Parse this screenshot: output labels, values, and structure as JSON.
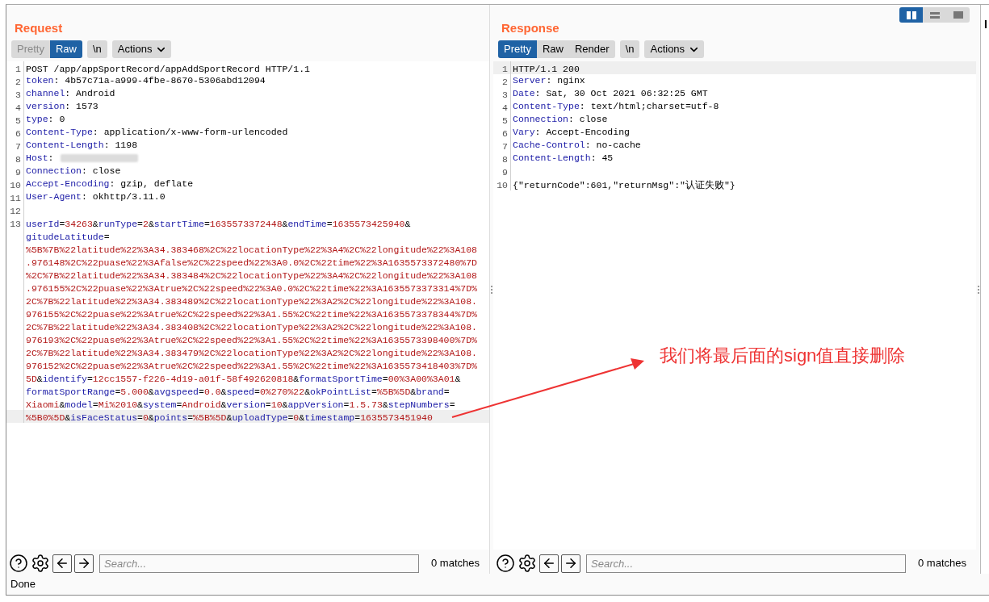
{
  "request": {
    "title": "Request",
    "tabs": [
      {
        "label": "Pretty",
        "selected": false,
        "disabled": true
      },
      {
        "label": "Raw",
        "selected": true
      }
    ],
    "newline_button": "\\n",
    "actions": "Actions",
    "lines": [
      {
        "num": "1",
        "kind": "plain",
        "text": "POST /app/appSportRecord/appAddSportRecord HTTP/1.1",
        "current": false
      },
      {
        "num": "2",
        "kind": "header",
        "text": "token: 4b57c71a-a999-4fbe-8670-5306abd12094",
        "current": false
      },
      {
        "num": "3",
        "kind": "header",
        "text": "channel: Android",
        "current": false
      },
      {
        "num": "4",
        "kind": "header",
        "text": "version: 1573",
        "current": false
      },
      {
        "num": "5",
        "kind": "header",
        "text": "type: 0",
        "current": false
      },
      {
        "num": "6",
        "kind": "header",
        "text": "Content-Type: application/x-www-form-urlencoded",
        "current": false
      },
      {
        "num": "7",
        "kind": "header",
        "text": "Content-Length: 1198",
        "current": false
      },
      {
        "num": "8",
        "kind": "redacted",
        "text": "Host:",
        "current": false
      },
      {
        "num": "9",
        "kind": "header",
        "text": "Connection: close",
        "current": false
      },
      {
        "num": "10",
        "kind": "header",
        "text": "Accept-Encoding: gzip, deflate",
        "current": false
      },
      {
        "num": "11",
        "kind": "header",
        "text": "User-Agent: okhttp/3.11.0",
        "current": false
      },
      {
        "num": "12",
        "kind": "blank",
        "current": false
      },
      {
        "num": "13",
        "kind": "params",
        "current": true,
        "rows": [
          "userId=34263&runType=2&startTime=1635573372448&endTime=1635573425940&",
          "gitudeLatitude=",
          "%5B%7B%22latitude%22%3A34.383468%2C%22locationType%22%3A4%2C%22longitude%22%3A108",
          ".976148%2C%22puase%22%3Afalse%2C%22speed%22%3A0.0%2C%22time%22%3A1635573372480%7D",
          "%2C%7B%22latitude%22%3A34.383484%2C%22locationType%22%3A4%2C%22longitude%22%3A108",
          ".976155%2C%22puase%22%3Atrue%2C%22speed%22%3A0.0%2C%22time%22%3A1635573373314%7D%",
          "2C%7B%22latitude%22%3A34.383489%2C%22locationType%22%3A2%2C%22longitude%22%3A108.",
          "976155%2C%22puase%22%3Atrue%2C%22speed%22%3A1.55%2C%22time%22%3A1635573378344%7D%",
          "2C%7B%22latitude%22%3A34.383408%2C%22locationType%22%3A2%2C%22longitude%22%3A108.",
          "976193%2C%22puase%22%3Atrue%2C%22speed%22%3A1.55%2C%22time%22%3A1635573398400%7D%",
          "2C%7B%22latitude%22%3A34.383479%2C%22locationType%22%3A2%2C%22longitude%22%3A108.",
          "976152%2C%22puase%22%3Atrue%2C%22speed%22%3A1.55%2C%22time%22%3A1635573418403%7D%",
          "5D&identify=12cc1557-f226-4d19-a01f-58f492620818&formatSportTime=00%3A00%3A01&",
          "formatSportRange=5.000&avgspeed=0.0&speed=0%270%22&okPointList=%5B%5D&brand=",
          "Xiaomi&model=Mi%2010&system=Android&version=10&appVersion=1.5.73&stepNumbers=",
          "%5B0%5D&isFaceStatus=0&points=%5B%5D&uploadType=0&timestamp=1635573451940"
        ]
      }
    ],
    "search": {
      "placeholder": "Search...",
      "matches": "0 matches"
    }
  },
  "response": {
    "title": "Response",
    "tabs": [
      {
        "label": "Pretty",
        "selected": true
      },
      {
        "label": "Raw",
        "selected": false
      },
      {
        "label": "Render",
        "selected": false
      }
    ],
    "newline_button": "\\n",
    "actions": "Actions",
    "lines": [
      {
        "num": "1",
        "kind": "plain",
        "text": "HTTP/1.1 200",
        "current": true
      },
      {
        "num": "2",
        "kind": "header",
        "text": "Server: nginx",
        "current": false
      },
      {
        "num": "3",
        "kind": "header",
        "text": "Date: Sat, 30 Oct 2021 06:32:25 GMT",
        "current": false
      },
      {
        "num": "4",
        "kind": "header",
        "text": "Content-Type: text/html;charset=utf-8",
        "current": false
      },
      {
        "num": "5",
        "kind": "header",
        "text": "Connection: close",
        "current": false
      },
      {
        "num": "6",
        "kind": "header",
        "text": "Vary: Accept-Encoding",
        "current": false
      },
      {
        "num": "7",
        "kind": "header",
        "text": "Cache-Control: no-cache",
        "current": false
      },
      {
        "num": "8",
        "kind": "header",
        "text": "Content-Length: 45",
        "current": false
      },
      {
        "num": "9",
        "kind": "blank",
        "current": false
      },
      {
        "num": "10",
        "kind": "plain",
        "text": "{\"returnCode\":601,\"returnMsg\":\"认证失败\"}",
        "current": false
      }
    ],
    "search": {
      "placeholder": "Search...",
      "matches": "0 matches"
    }
  },
  "layout_buttons": [
    {
      "kind": "columns",
      "selected": true
    },
    {
      "kind": "rows",
      "selected": false
    },
    {
      "kind": "single",
      "selected": false
    }
  ],
  "side_tab": "I",
  "annotation": "我们将最后面的sign值直接删除",
  "status_bar": "Done"
}
